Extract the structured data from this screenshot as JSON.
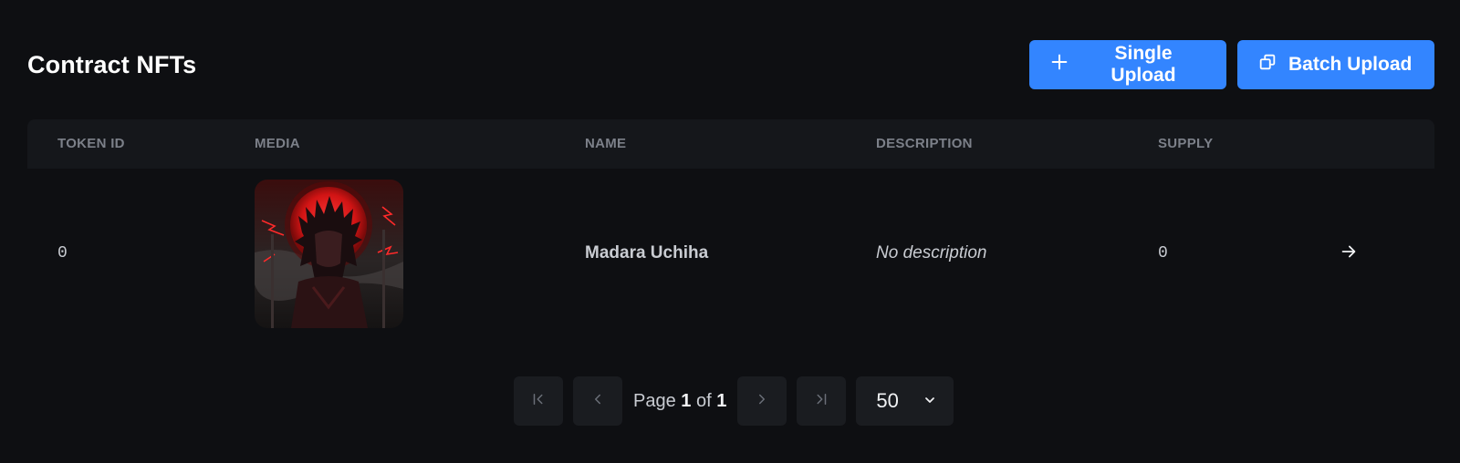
{
  "header": {
    "title": "Contract NFTs",
    "single_upload_label": "Single Upload",
    "batch_upload_label": "Batch Upload"
  },
  "table": {
    "columns": [
      "TOKEN ID",
      "MEDIA",
      "NAME",
      "DESCRIPTION",
      "SUPPLY"
    ],
    "rows": [
      {
        "token_id": "0",
        "name": "Madara Uchiha",
        "description": "No description",
        "supply": "0"
      }
    ]
  },
  "pagination": {
    "page_prefix": "Page",
    "current_page": "1",
    "of_label": "of",
    "total_pages": "1",
    "page_size": "50"
  },
  "colors": {
    "background": "#0e0f12",
    "header_row": "#15171b",
    "accent": "#3385ff"
  },
  "icons": [
    "plus-icon",
    "copy-icon",
    "arrow-right-icon",
    "first-page-icon",
    "prev-page-icon",
    "next-page-icon",
    "last-page-icon",
    "chevron-down-icon"
  ]
}
